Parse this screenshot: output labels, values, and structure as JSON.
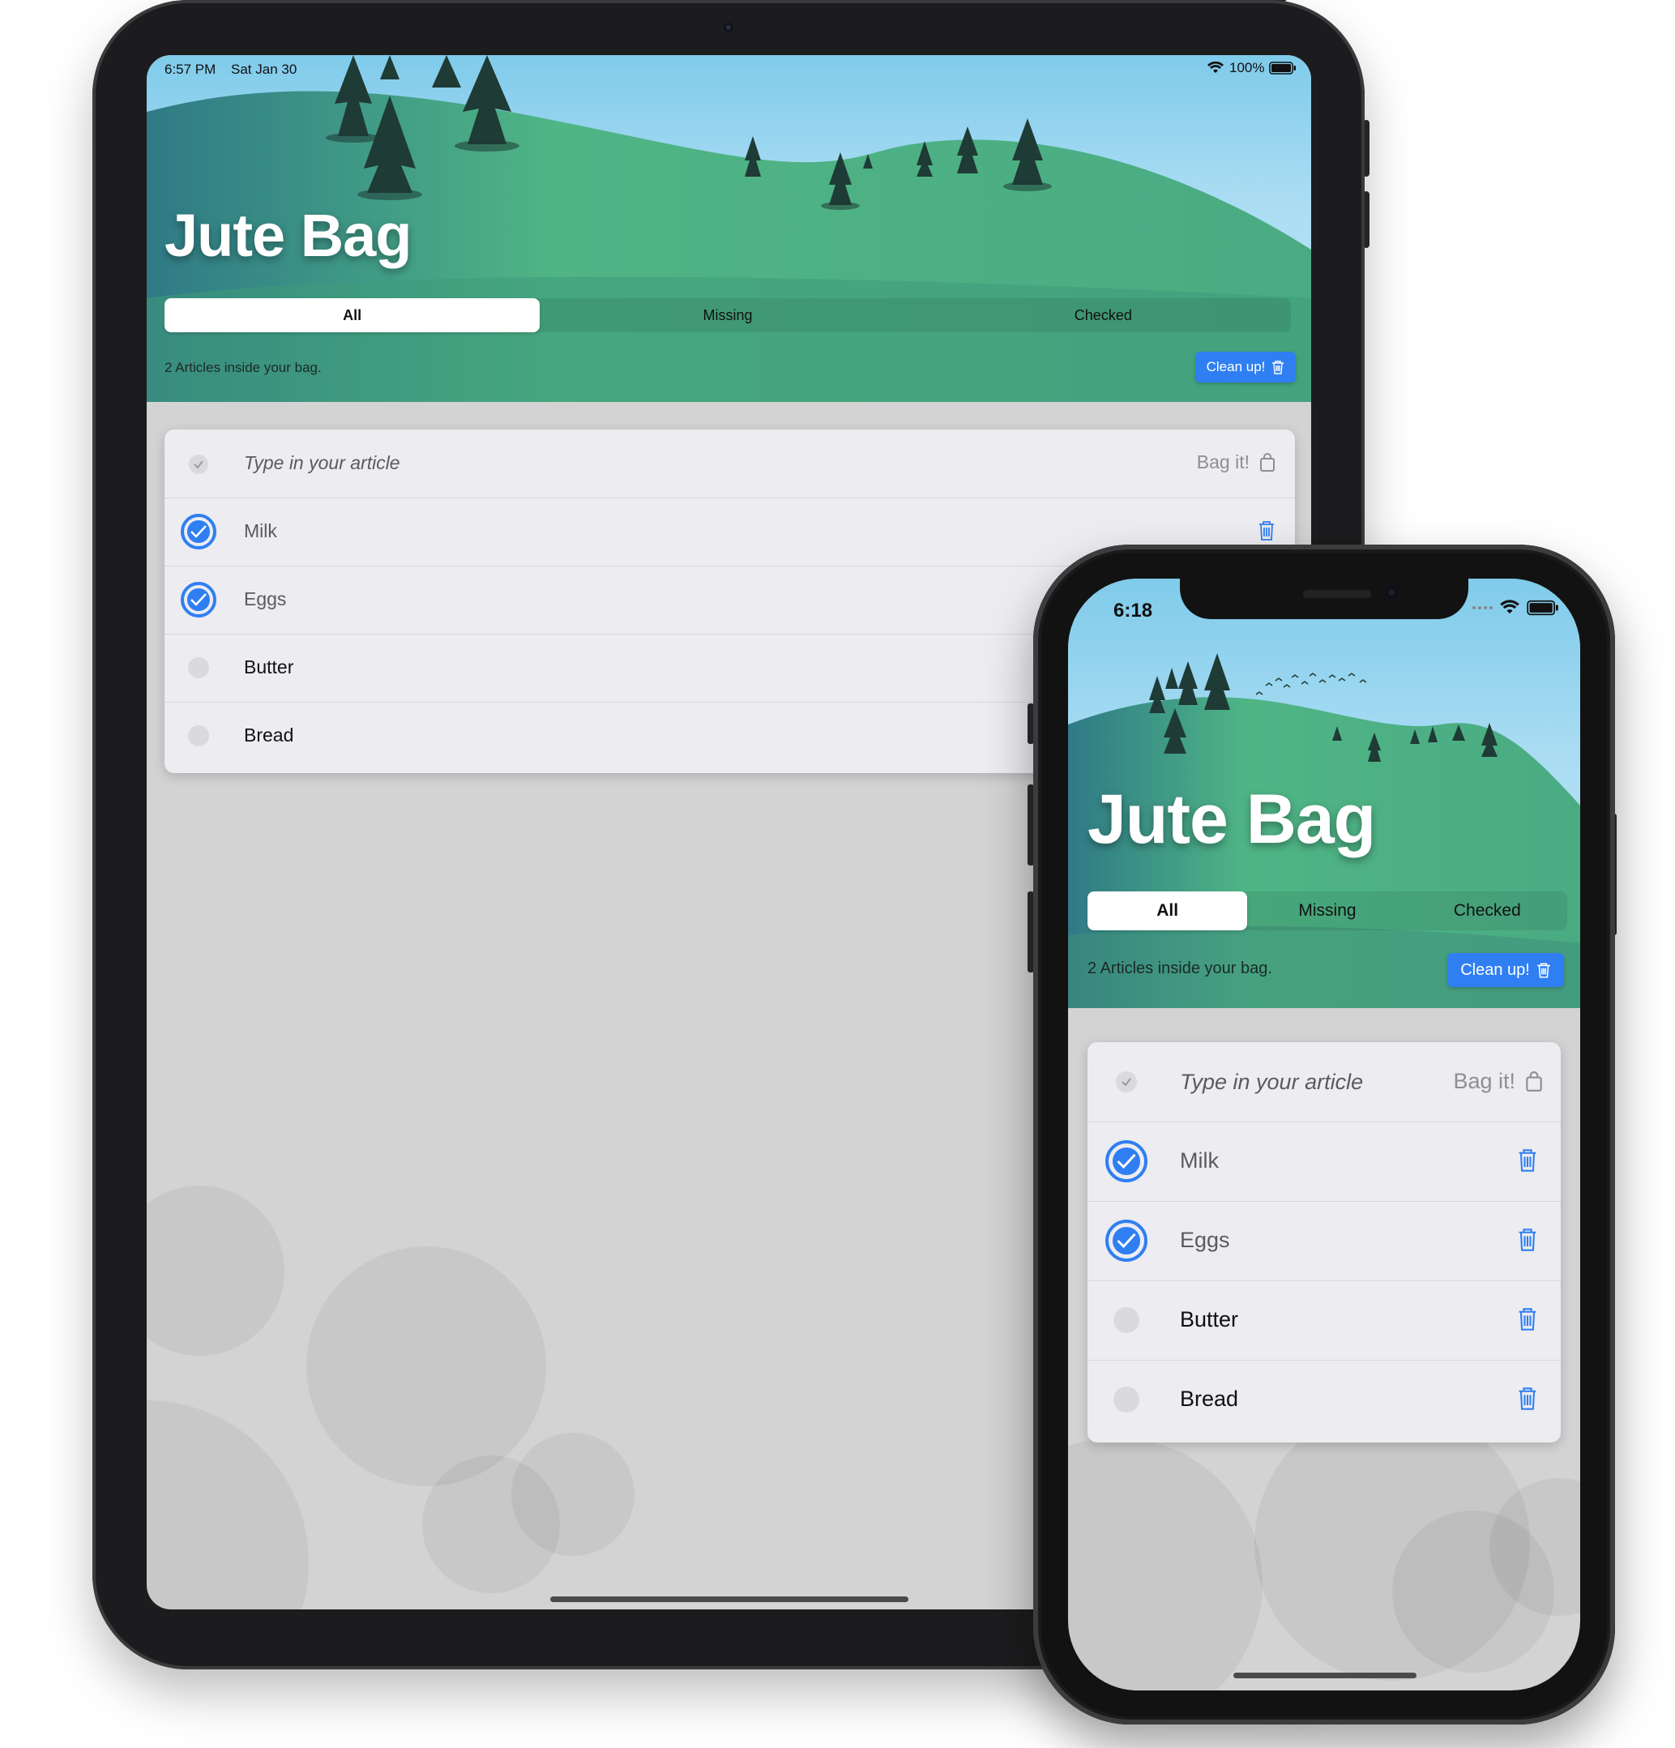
{
  "app": {
    "title": "Jute Bag",
    "tabs": [
      "All",
      "Missing",
      "Checked"
    ],
    "active_tab": "All",
    "info_text": "2 Articles inside your bag.",
    "cleanup_label": "Clean up!",
    "input_placeholder": "Type in your article",
    "bagit_label": "Bag it!",
    "items": [
      {
        "name": "Milk",
        "checked": true
      },
      {
        "name": "Eggs",
        "checked": true
      },
      {
        "name": "Butter",
        "checked": false
      },
      {
        "name": "Bread",
        "checked": false
      }
    ]
  },
  "ipad": {
    "status_time": "6:57 PM",
    "status_date": "Sat Jan 30",
    "battery": "100%"
  },
  "iphone": {
    "status_time": "6:18"
  },
  "colors": {
    "accent": "#2f7ff2",
    "hill": "#4fb585",
    "sky": "#8fd3f0",
    "list_bg": "#ececf1",
    "screen_bg": "#d3d3d3"
  }
}
